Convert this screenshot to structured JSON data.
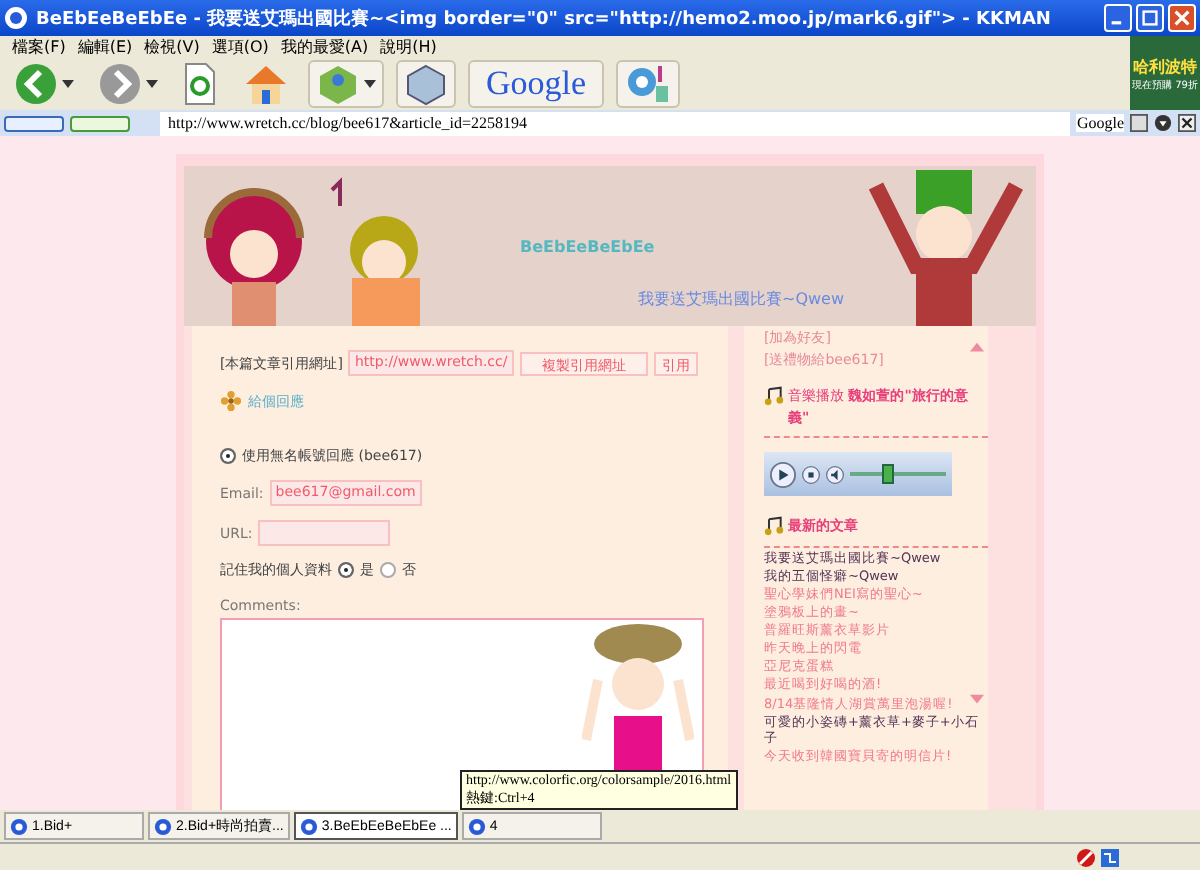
{
  "window": {
    "title": "BeEbEeBeEbEe - 我要送艾瑪出國比賽~<img border=\"0\" src=\"http://hemo2.moo.jp/mark6.gif\"> - KKMAN"
  },
  "menu": [
    "檔案(F)",
    "編輯(E)",
    "檢視(V)",
    "選項(O)",
    "我的最愛(A)",
    "說明(H)"
  ],
  "ad": {
    "title": "哈利波特",
    "subtitle": "現在預購 79折"
  },
  "toolbar": {
    "search_logo": "Google"
  },
  "address_bar": {
    "url": "http://www.wretch.cc/blog/bee617&article_id=2258194",
    "search_engine": "Google"
  },
  "blog": {
    "title": "BeEbEeBeEbEe",
    "subtitle": "我要送艾瑪出國比賽~Qwew"
  },
  "trackback": {
    "label": "[本篇文章引用網址]",
    "url": "http://www.wretch.cc/",
    "copy_button": "複製引用網址",
    "quote_button": "引用"
  },
  "reply_link": "給個回應",
  "comment_form": {
    "account_option": {
      "label": "使用無名帳號回應 (bee617)",
      "selected": true
    },
    "email_label": "Email:",
    "email": "bee617@gmail.com",
    "url_label": "URL:",
    "remember_label": "記住我的個人資料",
    "remember_options": [
      {
        "label": "是",
        "selected": true
      },
      {
        "label": "否",
        "selected": false
      }
    ],
    "comments_label": "Comments:"
  },
  "sidebar": {
    "links": [
      "[加為好友]",
      "[送禮物給bee617]"
    ],
    "music": {
      "title": "音樂播放 **魏如萱的\"旅行的意義\"**",
      "level": 0.4
    },
    "recent": {
      "title": "最新的文章",
      "posts": [
        {
          "title": "我要送艾瑪出國比賽~Qwew",
          "visited": true
        },
        {
          "title": "我的五個怪癖~Qwew",
          "visited": true
        },
        {
          "title": "聖心學妹們NEI寫的聖心~",
          "visited": false
        },
        {
          "title": "塗鴉板上的畫~",
          "visited": false
        },
        {
          "title": "普羅旺斯薰衣草影片",
          "visited": false
        },
        {
          "title": "昨天晚上的閃電",
          "visited": false
        },
        {
          "title": "亞尼克蛋糕",
          "visited": false
        },
        {
          "title": "最近喝到好喝的酒!",
          "visited": false
        },
        {
          "title": "8/14基隆情人湖賞萬里泡湯喔!",
          "visited": false
        },
        {
          "title": "可愛的小姿磚+薰衣草+麥子+小石子",
          "visited": true
        },
        {
          "title": "今天收到韓國寶貝寄的明信片!",
          "visited": false
        }
      ]
    }
  },
  "tabs": [
    {
      "label": "1.Bid+",
      "selected": false
    },
    {
      "label": "2.Bid+時尚拍賣...",
      "selected": false
    },
    {
      "label": "3.BeEbEeBeEbEe ...",
      "selected": true
    },
    {
      "label": "4",
      "selected": false
    }
  ],
  "tooltip": {
    "url": "http://www.colorfic.org/colorsample/2016.html",
    "hotkey": "熱鍵:Ctrl+4"
  }
}
